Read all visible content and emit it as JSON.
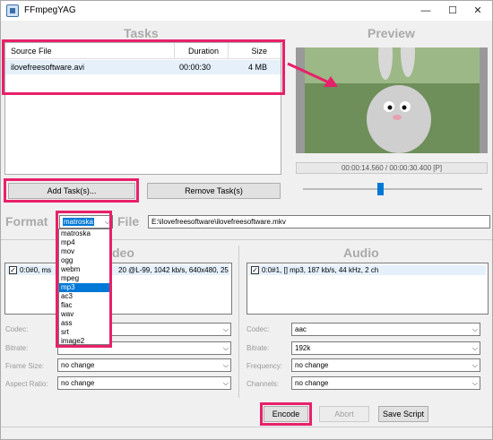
{
  "window": {
    "title": "FFmpegYAG"
  },
  "tasks": {
    "title": "Tasks",
    "columns": [
      "Source File",
      "Duration",
      "Size"
    ],
    "rows": [
      {
        "file": "ilovefreesoftware.avi",
        "duration": "00:00:30",
        "size": "4 MB"
      }
    ],
    "add_label": "Add Task(s)...",
    "remove_label": "Remove Task(s)"
  },
  "preview": {
    "title": "Preview",
    "time": "00:00:14.560 / 00:00:30.400 [P]",
    "slider_position": 0.43
  },
  "format": {
    "label": "Format",
    "selected": "matroska",
    "options": [
      "matroska",
      "mp4",
      "mov",
      "ogg",
      "webm",
      "mpeg",
      "mp3",
      "ac3",
      "flac",
      "wav",
      "ass",
      "srt",
      "image2"
    ],
    "highlighted": "mp3",
    "file_label": "File",
    "file_value": "E:\\ilovefreesoftware\\ilovefreesoftware.mkv"
  },
  "video": {
    "title_visible": "deo",
    "stream_prefix": "0:0#0, ms",
    "stream_suffix": "20 @L-99, 1042 kb/s, 640x480, 25",
    "fields": [
      {
        "label": "Codec:",
        "value": ""
      },
      {
        "label": "Bitrate:",
        "value": ""
      },
      {
        "label": "Frame Size:",
        "value": "no change"
      },
      {
        "label": "Aspect Ratio:",
        "value": "no change"
      }
    ]
  },
  "audio": {
    "title": "Audio",
    "stream": "0:0#1, [] mp3, 187 kb/s, 44 kHz, 2 ch",
    "fields": [
      {
        "label": "Codec:",
        "value": "aac"
      },
      {
        "label": "Bitrate:",
        "value": "192k"
      },
      {
        "label": "Frequency:",
        "value": "no change"
      },
      {
        "label": "Channels:",
        "value": "no change"
      }
    ]
  },
  "actions": {
    "encode": "Encode",
    "abort": "Abort",
    "save_script": "Save Script"
  },
  "colors": {
    "highlight": "#e8206a",
    "selection": "#0078d7"
  }
}
